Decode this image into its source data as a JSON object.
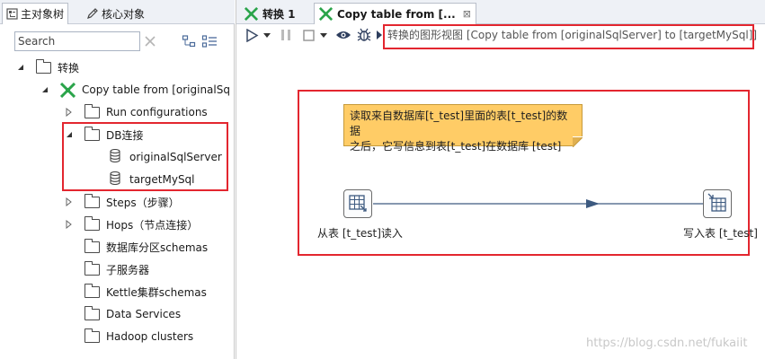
{
  "left_panel": {
    "tabs": [
      {
        "label": "主对象树",
        "icon": "object-tree-icon"
      },
      {
        "label": "核心对象",
        "icon": "pencil-icon"
      }
    ],
    "search": {
      "placeholder": "Search",
      "value": ""
    },
    "tree": {
      "root": "转换",
      "transformation": "Copy table from [originalSq",
      "items": {
        "run_configurations": "Run configurations",
        "db_connections": "DB连接",
        "db_original": "originalSqlServer",
        "db_target": "targetMySql",
        "steps": "Steps（步骤）",
        "hops": "Hops（节点连接）",
        "partition_schemas": "数据库分区schemas",
        "sub_servers": "子服务器",
        "kettle_cluster": "Kettle集群schemas",
        "data_services": "Data Services",
        "hadoop_clusters": "Hadoop clusters"
      }
    }
  },
  "editor": {
    "tabs": [
      {
        "label": "转换 1",
        "icon": "transformation-icon"
      },
      {
        "label": "Copy table from [...",
        "icon": "transformation-icon",
        "close": "⊠"
      }
    ],
    "toolbar": {
      "icons": [
        "run-icon",
        "dropdown-icon",
        "pause-icon",
        "stop-icon",
        "dropdown-icon",
        "preview-eye-icon",
        "debug-bug-icon",
        "replay-icon"
      ]
    },
    "canvas_title": "转换的图形视图 [Copy table from [originalSqlServer] to [targetMySql]]",
    "note": {
      "line1": "读取来自数据库[t_test]里面的表[t_test]的数据",
      "line2": "之后，它写信息到表[t_test]在数据库 [test]"
    },
    "steps": {
      "input": "从表 [t_test]读入",
      "output": "写入表 [t_test]"
    },
    "highlight_color": "#e3262f",
    "note_color": "#ffcc66",
    "hop_color": "#3d5a80"
  },
  "watermark": "https://blog.csdn.net/fukaiit"
}
